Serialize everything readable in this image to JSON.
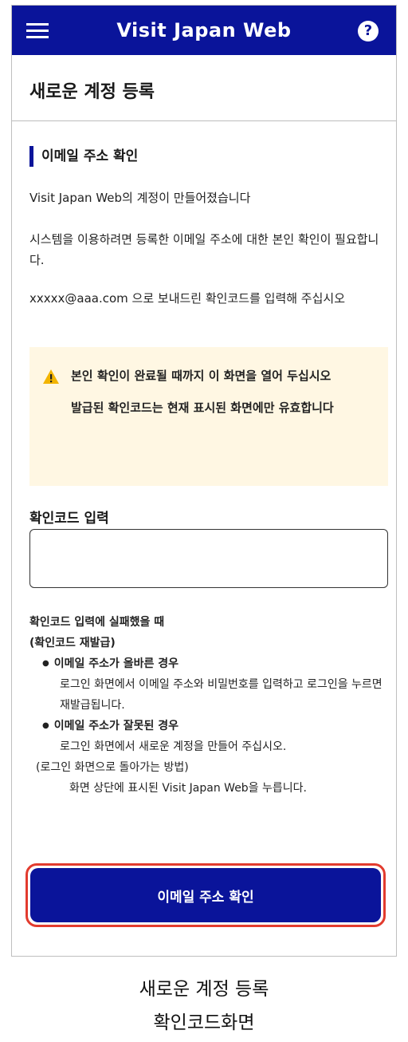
{
  "header": {
    "brand": "Visit Japan Web",
    "help_glyph": "?",
    "icons": [
      "menu-icon",
      "help-icon"
    ],
    "bg_color": "#0a149a"
  },
  "page": {
    "title": "새로운 계정 등록"
  },
  "section": {
    "title": "이메일 주소 확인",
    "paragraphs": [
      "Visit Japan Web의 계정이 만들어졌습니다",
      "시스템을 이용하려면 등록한 이메일 주소에 대한 본인 확인이 필요합니다.",
      "xxxxx@aaa.com 으로 보내드린 확인코드를 입력해 주십시오"
    ]
  },
  "notice": {
    "icon": "warning-icon",
    "lines": [
      "본인 확인이 완료될 때까지 이 화면을 열어 두십시오",
      "발급된 확인코드는 현재 표시된 화면에만 유효합니다"
    ],
    "bg_color": "#fff7e3"
  },
  "code_input": {
    "label": "확인코드 입력",
    "value": "",
    "placeholder": ""
  },
  "help_block": {
    "title_line1": "확인코드 입력에 실패했을 때",
    "title_line2": "(확인코드 재발급)",
    "case1_title": "이메일 주소가 올바른 경우",
    "case1_desc": "로그인 화면에서 이메일 주소와 비밀번호를 입력하고 로그인을 누르면 재발급됩니다.",
    "case2_title": "이메일 주소가 잘못된 경우",
    "case2_desc": "로그인 화면에서 새로운 계정을 만들어 주십시오.",
    "back_title": "(로그인 화면으로 돌아가는 방법)",
    "back_desc": "화면 상단에 표시된 Visit Japan Web을 누릅니다."
  },
  "primary_button": {
    "label": "이메일 주소 확인",
    "highlight_color": "#e23b2e"
  },
  "caption": {
    "line1": "새로운 계정 등록",
    "line2": "확인코드화면"
  }
}
